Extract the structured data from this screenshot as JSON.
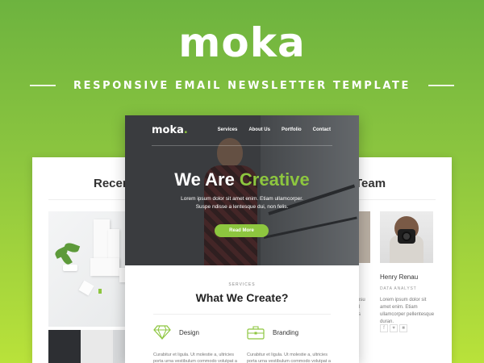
{
  "brand": {
    "name": "moka",
    "tagline": "RESPONSIVE EMAIL NEWSLETTER TEMPLATE"
  },
  "left_card": {
    "heading_visible": "Recen"
  },
  "right_card": {
    "heading_visible": "Team",
    "member": {
      "name": "Henry Renau",
      "role": "DATA ANALYST",
      "description": "Lorem ipsum dolor sit amet enim. Etiam ullamcorper pellentesque duran."
    },
    "left_member_desc_visible": [
      "Lorem ipsum",
      "Etiam ull",
      "pellentes"
    ],
    "social_icons": [
      "f",
      "♥",
      "■"
    ]
  },
  "email": {
    "logo": "moka",
    "logo_dot": ".",
    "nav": [
      "Services",
      "About Us",
      "Portfolio",
      "Contact"
    ],
    "hero": {
      "title_plain": "We Are ",
      "title_accent": "Creative",
      "text_line1": "Lorem ipsum dolor sit amet enim. Etiam ullamcorper.",
      "text_line2": "Suspe ndisse a lentesque dui, non felis.",
      "cta": "Read More"
    },
    "services": {
      "eyebrow": "SERVICES",
      "title": "What We Create?",
      "items": [
        {
          "label": "Design",
          "icon": "diamond-icon",
          "desc": "Curabitur et ligula. Ut molestie a, ultricies porta urna vestibulum commodo volutpat a"
        },
        {
          "label": "Branding",
          "icon": "briefcase-icon",
          "desc": "Curabitur et ligula. Ut molestie a, ultricies porta urna vestibulum commodo volutpat a"
        }
      ]
    }
  },
  "colors": {
    "accent": "#8dc63f",
    "background_top": "#6db33f",
    "background_bottom": "#b9e23a"
  }
}
